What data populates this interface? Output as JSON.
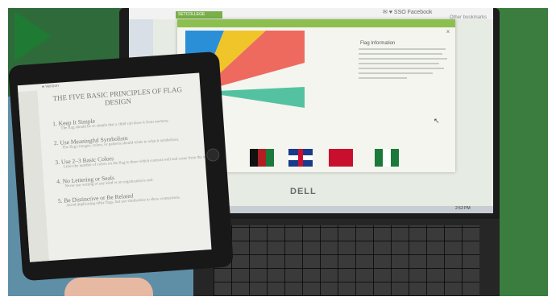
{
  "browser": {
    "tab_label": "SETCOLLEGE",
    "url": "✉ ♥ SSO Facebook",
    "bookmarks": "Other bookmarks"
  },
  "modal": {
    "title": "Flag Information"
  },
  "taskbar": {
    "time": "2:53 PM"
  },
  "laptop": {
    "brand": "DELL"
  },
  "tablet": {
    "status": "● Verizon",
    "doc_title": "THE FIVE BASIC PRINCIPLES OF FLAG DESIGN",
    "principles": [
      {
        "heading": "1. Keep It Simple",
        "sub": "The flag should be so simple that a child can draw it from memory."
      },
      {
        "heading": "2. Use Meaningful Symbolism",
        "sub": "The flag's images, colors, or patterns should relate to what it symbolizes."
      },
      {
        "heading": "3. Use 2–3 Basic Colors",
        "sub": "Limit the number of colors on the flag to three which contrast well and come from the standard color set."
      },
      {
        "heading": "4. No Lettering or Seals",
        "sub": "Never use writing of any kind or an organization's seal."
      },
      {
        "heading": "5. Be Distinctive or Be Related",
        "sub": "Avoid duplicating other flags, but use similarities to show connections."
      }
    ]
  },
  "colors": {
    "flag_blue": "#2b8fd8",
    "flag_yellow": "#f0c52a",
    "flag_red": "#ee6a5f",
    "flag_green": "#54c2a0",
    "play_green": "#1f7a33"
  }
}
